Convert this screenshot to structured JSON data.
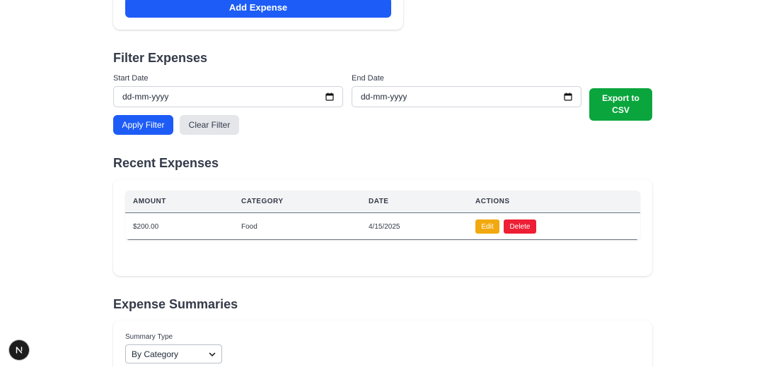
{
  "add_expense": {
    "button_label": "Add Expense"
  },
  "filter": {
    "title": "Filter Expenses",
    "start_date_label": "Start Date",
    "start_date_value": "dd-mm-yyyy",
    "end_date_label": "End Date",
    "end_date_value": "dd-mm-yyyy",
    "export_label": "Export to CSV",
    "apply_label": "Apply Filter",
    "clear_label": "Clear Filter"
  },
  "recent": {
    "title": "Recent Expenses",
    "columns": [
      "Amount",
      "Category",
      "Date",
      "Actions"
    ],
    "rows": [
      {
        "amount": "$200.00",
        "category": "Food",
        "date": "4/15/2025",
        "edit_label": "Edit",
        "delete_label": "Delete"
      }
    ]
  },
  "summaries": {
    "title": "Expense Summaries",
    "type_label": "Summary Type",
    "selected_type": "By Category"
  },
  "badge": {
    "letter": "N"
  },
  "colors": {
    "primary": "#1d5cf6",
    "export": "#0aa63d",
    "edit": "#f2a90f",
    "delete": "#ee1f34",
    "heading": "#333a48"
  }
}
